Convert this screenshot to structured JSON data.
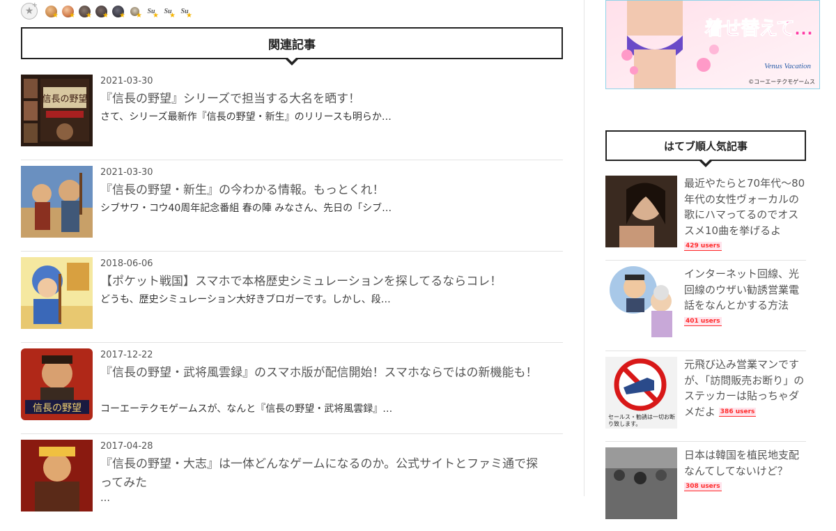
{
  "stars": {
    "add_icon": "add-star-icon",
    "users": [
      {
        "kind": "avatar",
        "color": "#c9884a"
      },
      {
        "kind": "avatar",
        "color": "#d17a4a"
      },
      {
        "kind": "avatar",
        "color": "#5a4a44"
      },
      {
        "kind": "avatar",
        "color": "#4a4040"
      },
      {
        "kind": "avatar",
        "color": "#3c3c46"
      },
      {
        "kind": "avatar",
        "color": "#9a8a70"
      },
      {
        "kind": "text",
        "label": "Su"
      },
      {
        "kind": "text",
        "label": "Su"
      },
      {
        "kind": "text",
        "label": "Su"
      }
    ]
  },
  "related": {
    "heading": "関連記事",
    "articles": [
      {
        "date": "2021-03-30",
        "title": "『信長の野望』シリーズで担当する大名を晒す！",
        "excerpt": "さて、シリーズ最新作『信長の野望・新生』のリリースも明らか…"
      },
      {
        "date": "2021-03-30",
        "title": "『信長の野望・新生』の今わかる情報。もっとくれ！",
        "excerpt": "シブサワ・コウ40周年記念番組 春の陣 みなさん、先日の「シブ…"
      },
      {
        "date": "2018-06-06",
        "title": "【ポケット戦国】スマホで本格歴史シミュレーションを探してるならコレ！",
        "excerpt": "どうも、歴史シミュレーション大好きブロガーです。しかし、段…"
      },
      {
        "date": "2017-12-22",
        "title": "『信長の野望・武将風雲録』のスマホ版が配信開始！スマホならではの新機能も！",
        "excerpt": "コーエーテクモゲームスが、なんと『信長の野望・武将風雲録』…"
      },
      {
        "date": "2017-04-28",
        "title": "『信長の野望・大志』は一体どんなゲームになるのか。公式サイトとファミ通で探ってみた",
        "excerpt": "…"
      }
    ]
  },
  "banner": {
    "text": "着せ替えて…",
    "logo": "Venus Vacation",
    "copyright": "©コーエーテクモゲームス"
  },
  "popular": {
    "heading": "はてブ順人気記事",
    "items": [
      {
        "title": "最近やたらと70年代〜80年代の女性ヴォーカルの歌にハマってるのでオススメ10曲を挙げるよ",
        "users": "429 users"
      },
      {
        "title": "インターネット回線、光回線のウザい勧誘営業電話をなんとかする方法",
        "users": "401 users"
      },
      {
        "title": "元飛び込み営業マンですが、「訪問販売お断り」のステッカーは貼っちゃダメだよ",
        "users": "386 users",
        "sticker_text": "セールス・勧誘は一切お断り致します。"
      },
      {
        "title": "日本は韓国を植民地支配なんてしてないけど？",
        "users": "308 users"
      }
    ]
  }
}
